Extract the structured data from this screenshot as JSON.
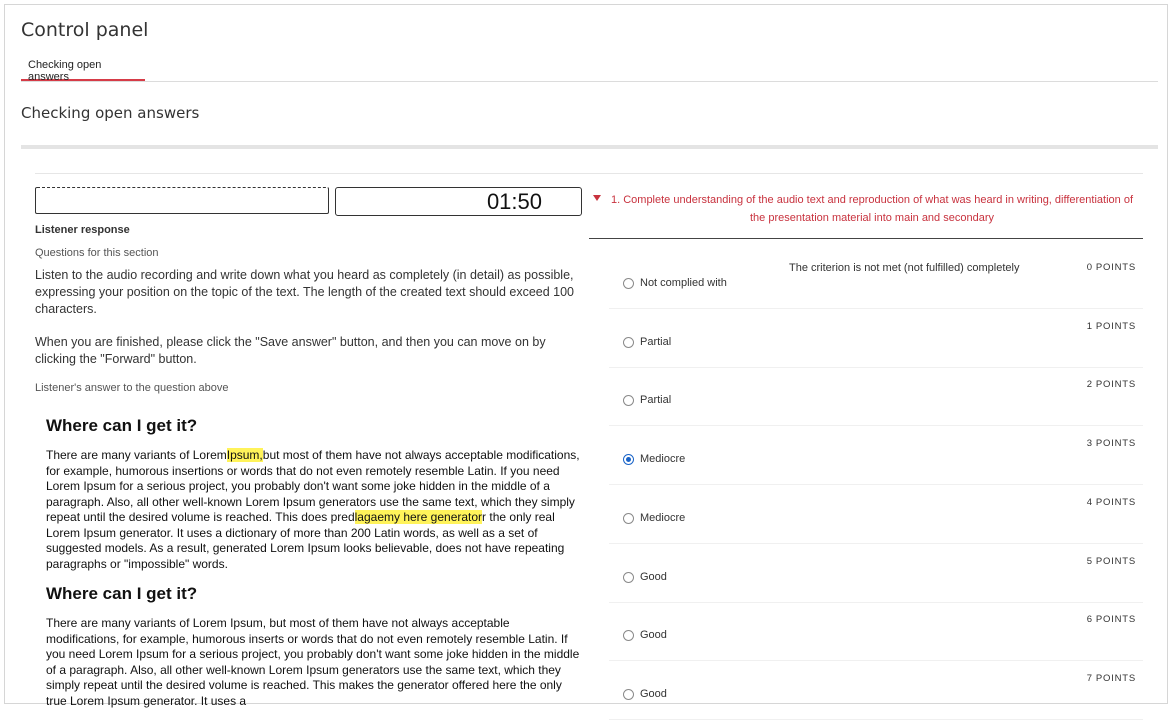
{
  "header": {
    "title": "Control panel",
    "tab_label": "Checking open answers"
  },
  "section": {
    "title": "Checking open answers"
  },
  "player": {
    "time": "01:50"
  },
  "left": {
    "listener_label": "Listener response",
    "questions_label": "Questions for this section",
    "instruction_1": "Listen to the audio recording and write down what you heard as completely (in detail) as possible, expressing your position on the topic of the text. The length of the created text should exceed 100 characters.",
    "instruction_2": "When you are finished, please click the \"Save answer\" button, and then you can move on by clicking the \"Forward\" button.",
    "answer_label": "Listener's answer to the question above",
    "answer": {
      "heading_1": "Where can I get it?",
      "p1_a": "There are many variants of Lorem",
      "p1_hl1": "Ipsum,",
      "p1_b": "but most of them have not always acceptable modifications, for example, humorous insertions or words that do not even remotely resemble Latin. If you need Lorem Ipsum for a serious project, you probably don't want some joke hidden in the middle of a paragraph. Also, all other well-known Lorem Ipsum generators use the same text, which they simply repeat until the desired volume is reached. This does pred",
      "p1_hl2": "lagaemy here generator",
      "p1_c": "r the only real Lorem Ipsum generator. It uses a dictionary of more than 200 Latin words, as well as a set of suggested models. As a result, generated Lorem Ipsum looks believable, does not have repeating paragraphs or \"impossible\" words.",
      "heading_2": "Where can I get it?",
      "p2": "There are many variants of Lorem Ipsum, but most of them have not always acceptable modifications, for example, humorous inserts or words that do not even remotely resemble Latin. If you need Lorem Ipsum for a serious project, you probably don't want some joke hidden in the middle of a paragraph. Also, all other well-known Lorem Ipsum generators use the same text, which they simply repeat until the desired volume is reached. This makes the generator offered here the only true Lorem Ipsum generator. It uses a"
    }
  },
  "right": {
    "criterion_title": "1. Complete understanding of the audio text and reproduction of what was heard in writing, differentiation of the presentation material into main and secondary",
    "criterion_desc": "The criterion is not met (not fulfilled) completely",
    "points_unit": "POINTS",
    "options": [
      {
        "label": "Not complied with",
        "points": "0",
        "checked": false
      },
      {
        "label": "Partial",
        "points": "1",
        "checked": false
      },
      {
        "label": "Partial",
        "points": "2",
        "checked": false
      },
      {
        "label": "Mediocre",
        "points": "3",
        "checked": true
      },
      {
        "label": "Mediocre",
        "points": "4",
        "checked": false
      },
      {
        "label": "Good",
        "points": "5",
        "checked": false
      },
      {
        "label": "Good",
        "points": "6",
        "checked": false
      },
      {
        "label": "Good",
        "points": "7",
        "checked": false
      }
    ]
  },
  "colors": {
    "accent_red": "#c8323e",
    "tab_underline": "#d63b47",
    "highlight": "#fff35a",
    "radio_checked": "#1a64c8"
  }
}
